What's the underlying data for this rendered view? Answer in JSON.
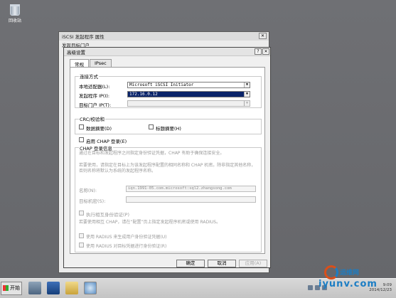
{
  "desktop": {
    "recycle_label": "回收站"
  },
  "bg_window": {
    "title": "iSCSI 发起程序 属性",
    "tab": "发现目标门户"
  },
  "dialog": {
    "title": "高级设置",
    "tabs": [
      {
        "label": "常规"
      },
      {
        "label": "IPsec"
      }
    ],
    "connect": {
      "group_label": "连接方式",
      "adapter_label": "本地适配器(L):",
      "adapter_value": "Microsoft iSCSI Initiator",
      "ip_label": "发起程序 IP(I):",
      "ip_value": "172.16.0.12",
      "portal_label": "目标门户 IP(T):",
      "portal_value": ""
    },
    "crc": {
      "group_label": "CRC/校验和",
      "data_digest": "数据摘要(D)",
      "header_digest": "标题摘要(H)"
    },
    "chap": {
      "enable_label": "启用 CHAP 登录(E)",
      "group_label": "CHAP 登录信息",
      "desc1": "通过在目标和发起程序之间指定身份验证凭据，CHAP 有助于确保连接安全。",
      "desc2": "若要使用，请指定在目标上为该发起程序配置的相同名称和 CHAP 机密。除非指定其他名称，否则名称将默认为系统的发起程序名称。",
      "name_label": "名称(N):",
      "name_value": "iqn.1991-05.com.microsoft:sql2.zhangsong.com",
      "secret_label": "目标机密(S):",
      "mutual_label": "执行相互身份验证(P)",
      "mutual_desc": "若要使用相互 CHAP，请在“配置”页上指定发起程序机密或使用 RADIUS。",
      "radius_user": "使用 RADIUS 来生成用户身份验证凭据(U)",
      "radius_target": "使用 RADIUS 对目标凭据进行身份验证(R)"
    },
    "buttons": {
      "ok": "确定",
      "cancel": "取消",
      "apply": "应用(A)"
    }
  },
  "taskbar": {
    "start_label": "开始",
    "clock_time": "9:09",
    "clock_date": "2014/12/23"
  },
  "watermark": {
    "line1": "运维网",
    "line2": "iyunv.com"
  }
}
